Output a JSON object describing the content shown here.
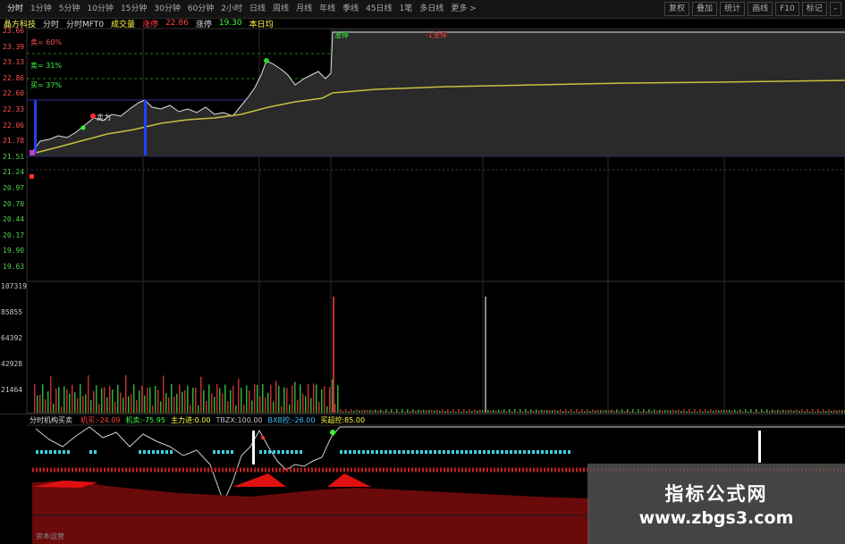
{
  "toolbar": {
    "periods": [
      "分时",
      "1分钟",
      "5分钟",
      "10分钟",
      "15分钟",
      "30分钟",
      "60分钟",
      "2小时",
      "日线",
      "周线",
      "月线",
      "年线",
      "季线",
      "45日线",
      "1笔",
      "多日线",
      "更多 >"
    ],
    "active_index": 0,
    "right_buttons": [
      "复权",
      "叠加",
      "统计",
      "画线",
      "F10",
      "标记",
      "-"
    ]
  },
  "info": {
    "stock_name": "晶方科技",
    "view_label": "分时",
    "indicator_label": "分时MFT0",
    "volume_label": "成交量",
    "latest_label": "涨停",
    "latest_value": "22.86",
    "change_label": "涨停",
    "change_value": "19.30",
    "extra_label": "本日均"
  },
  "price_axis": [
    "23.66",
    "23.39",
    "23.13",
    "22.86",
    "22.60",
    "22.33",
    "22.06",
    "21.78",
    "21.51",
    "21.24",
    "20.97",
    "20.70",
    "20.44",
    "20.17",
    "19.90",
    "19.63"
  ],
  "volume_axis": [
    "107319",
    "85855",
    "64392",
    "42928",
    "21464"
  ],
  "main_labels": {
    "sell_line": "卖= 60%",
    "mid_line": "卖= 31%",
    "buy_line": "买= 37%",
    "top_marker": "涨停",
    "top_red_marker": "-1涨停",
    "cross_label": "卖力"
  },
  "indicator": {
    "name": "分时机构买卖",
    "items": [
      {
        "label": "机买",
        "value": "-24.09",
        "color": "#ff4040"
      },
      {
        "label": "机卖",
        "value": "-75.95",
        "color": "#40ff40"
      },
      {
        "label": "主力进",
        "value": "0.00",
        "color": "#ffff40"
      },
      {
        "label": "TBZX",
        "value": "100.00",
        "color": "#c0c0c0"
      },
      {
        "label": "BXB控",
        "value": "-26.00",
        "color": "#40c0ff"
      },
      {
        "label": "买超控",
        "value": "85.00",
        "color": "#ffff40"
      }
    ]
  },
  "bottom_label": "资本运营",
  "watermark": {
    "title": "指标公式网",
    "url": "www.zbgs3.com"
  },
  "colors": {
    "price_line": "#e8e8e8",
    "avg_line": "#c8c040",
    "up": "#ff3030",
    "down": "#30ff30",
    "axis_red": "#ff5050",
    "axis_green": "#50d050"
  }
}
